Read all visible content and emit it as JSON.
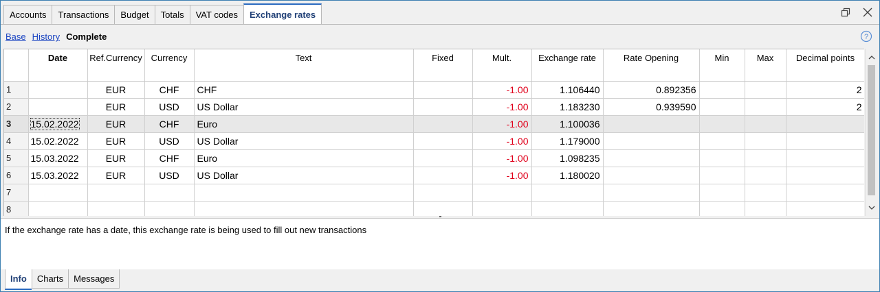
{
  "top_tabs": [
    {
      "label": "Accounts",
      "active": false
    },
    {
      "label": "Transactions",
      "active": false
    },
    {
      "label": "Budget",
      "active": false
    },
    {
      "label": "Totals",
      "active": false
    },
    {
      "label": "VAT codes",
      "active": false
    },
    {
      "label": "Exchange rates",
      "active": true
    }
  ],
  "window_icons": [
    "restore-icon",
    "close-icon"
  ],
  "views": {
    "base": "Base",
    "history": "History",
    "complete": "Complete"
  },
  "help_icon": "question-circle-icon",
  "table": {
    "columns": [
      "",
      "Date",
      "Ref.Currency",
      "Currency",
      "Text",
      "Fixed",
      "Mult.",
      "Exchange rate",
      "Rate Opening",
      "Min",
      "Max",
      "Decimal points"
    ],
    "rows": [
      {
        "num": "1",
        "date": "",
        "ref": "EUR",
        "cur": "CHF",
        "text": "CHF",
        "fixed": "",
        "mult": "-1.00",
        "rate": "1.106440",
        "opening": "0.892356",
        "min": "",
        "max": "",
        "dec": "2",
        "selected": false
      },
      {
        "num": "2",
        "date": "",
        "ref": "EUR",
        "cur": "USD",
        "text": "US Dollar",
        "fixed": "",
        "mult": "-1.00",
        "rate": "1.183230",
        "opening": "0.939590",
        "min": "",
        "max": "",
        "dec": "2",
        "selected": false
      },
      {
        "num": "3",
        "date": "15.02.2022",
        "ref": "EUR",
        "cur": "CHF",
        "text": "Euro",
        "fixed": "",
        "mult": "-1.00",
        "rate": "1.100036",
        "opening": "",
        "min": "",
        "max": "",
        "dec": "",
        "selected": true
      },
      {
        "num": "4",
        "date": "15.02.2022",
        "ref": "EUR",
        "cur": "USD",
        "text": "US Dollar",
        "fixed": "",
        "mult": "-1.00",
        "rate": "1.179000",
        "opening": "",
        "min": "",
        "max": "",
        "dec": "",
        "selected": false
      },
      {
        "num": "5",
        "date": "15.03.2022",
        "ref": "EUR",
        "cur": "CHF",
        "text": "Euro",
        "fixed": "",
        "mult": "-1.00",
        "rate": "1.098235",
        "opening": "",
        "min": "",
        "max": "",
        "dec": "",
        "selected": false
      },
      {
        "num": "6",
        "date": "15.03.2022",
        "ref": "EUR",
        "cur": "USD",
        "text": "US Dollar",
        "fixed": "",
        "mult": "-1.00",
        "rate": "1.180020",
        "opening": "",
        "min": "",
        "max": "",
        "dec": "",
        "selected": false
      },
      {
        "num": "7",
        "date": "",
        "ref": "",
        "cur": "",
        "text": "",
        "fixed": "",
        "mult": "",
        "rate": "",
        "opening": "",
        "min": "",
        "max": "",
        "dec": "",
        "selected": false
      },
      {
        "num": "8",
        "date": "",
        "ref": "",
        "cur": "",
        "text": "",
        "fixed": "",
        "mult": "",
        "rate": "",
        "opening": "",
        "min": "",
        "max": "",
        "dec": "",
        "selected": false
      }
    ]
  },
  "info": {
    "text": "If the exchange rate has a date, this exchange rate is being used to fill out new transactions"
  },
  "bottom_tabs": [
    {
      "label": "Info",
      "active": true
    },
    {
      "label": "Charts",
      "active": false
    },
    {
      "label": "Messages",
      "active": false
    }
  ],
  "colors": {
    "accent": "#2a6ac0",
    "negative": "#e0001b",
    "link": "#1a44c2"
  }
}
